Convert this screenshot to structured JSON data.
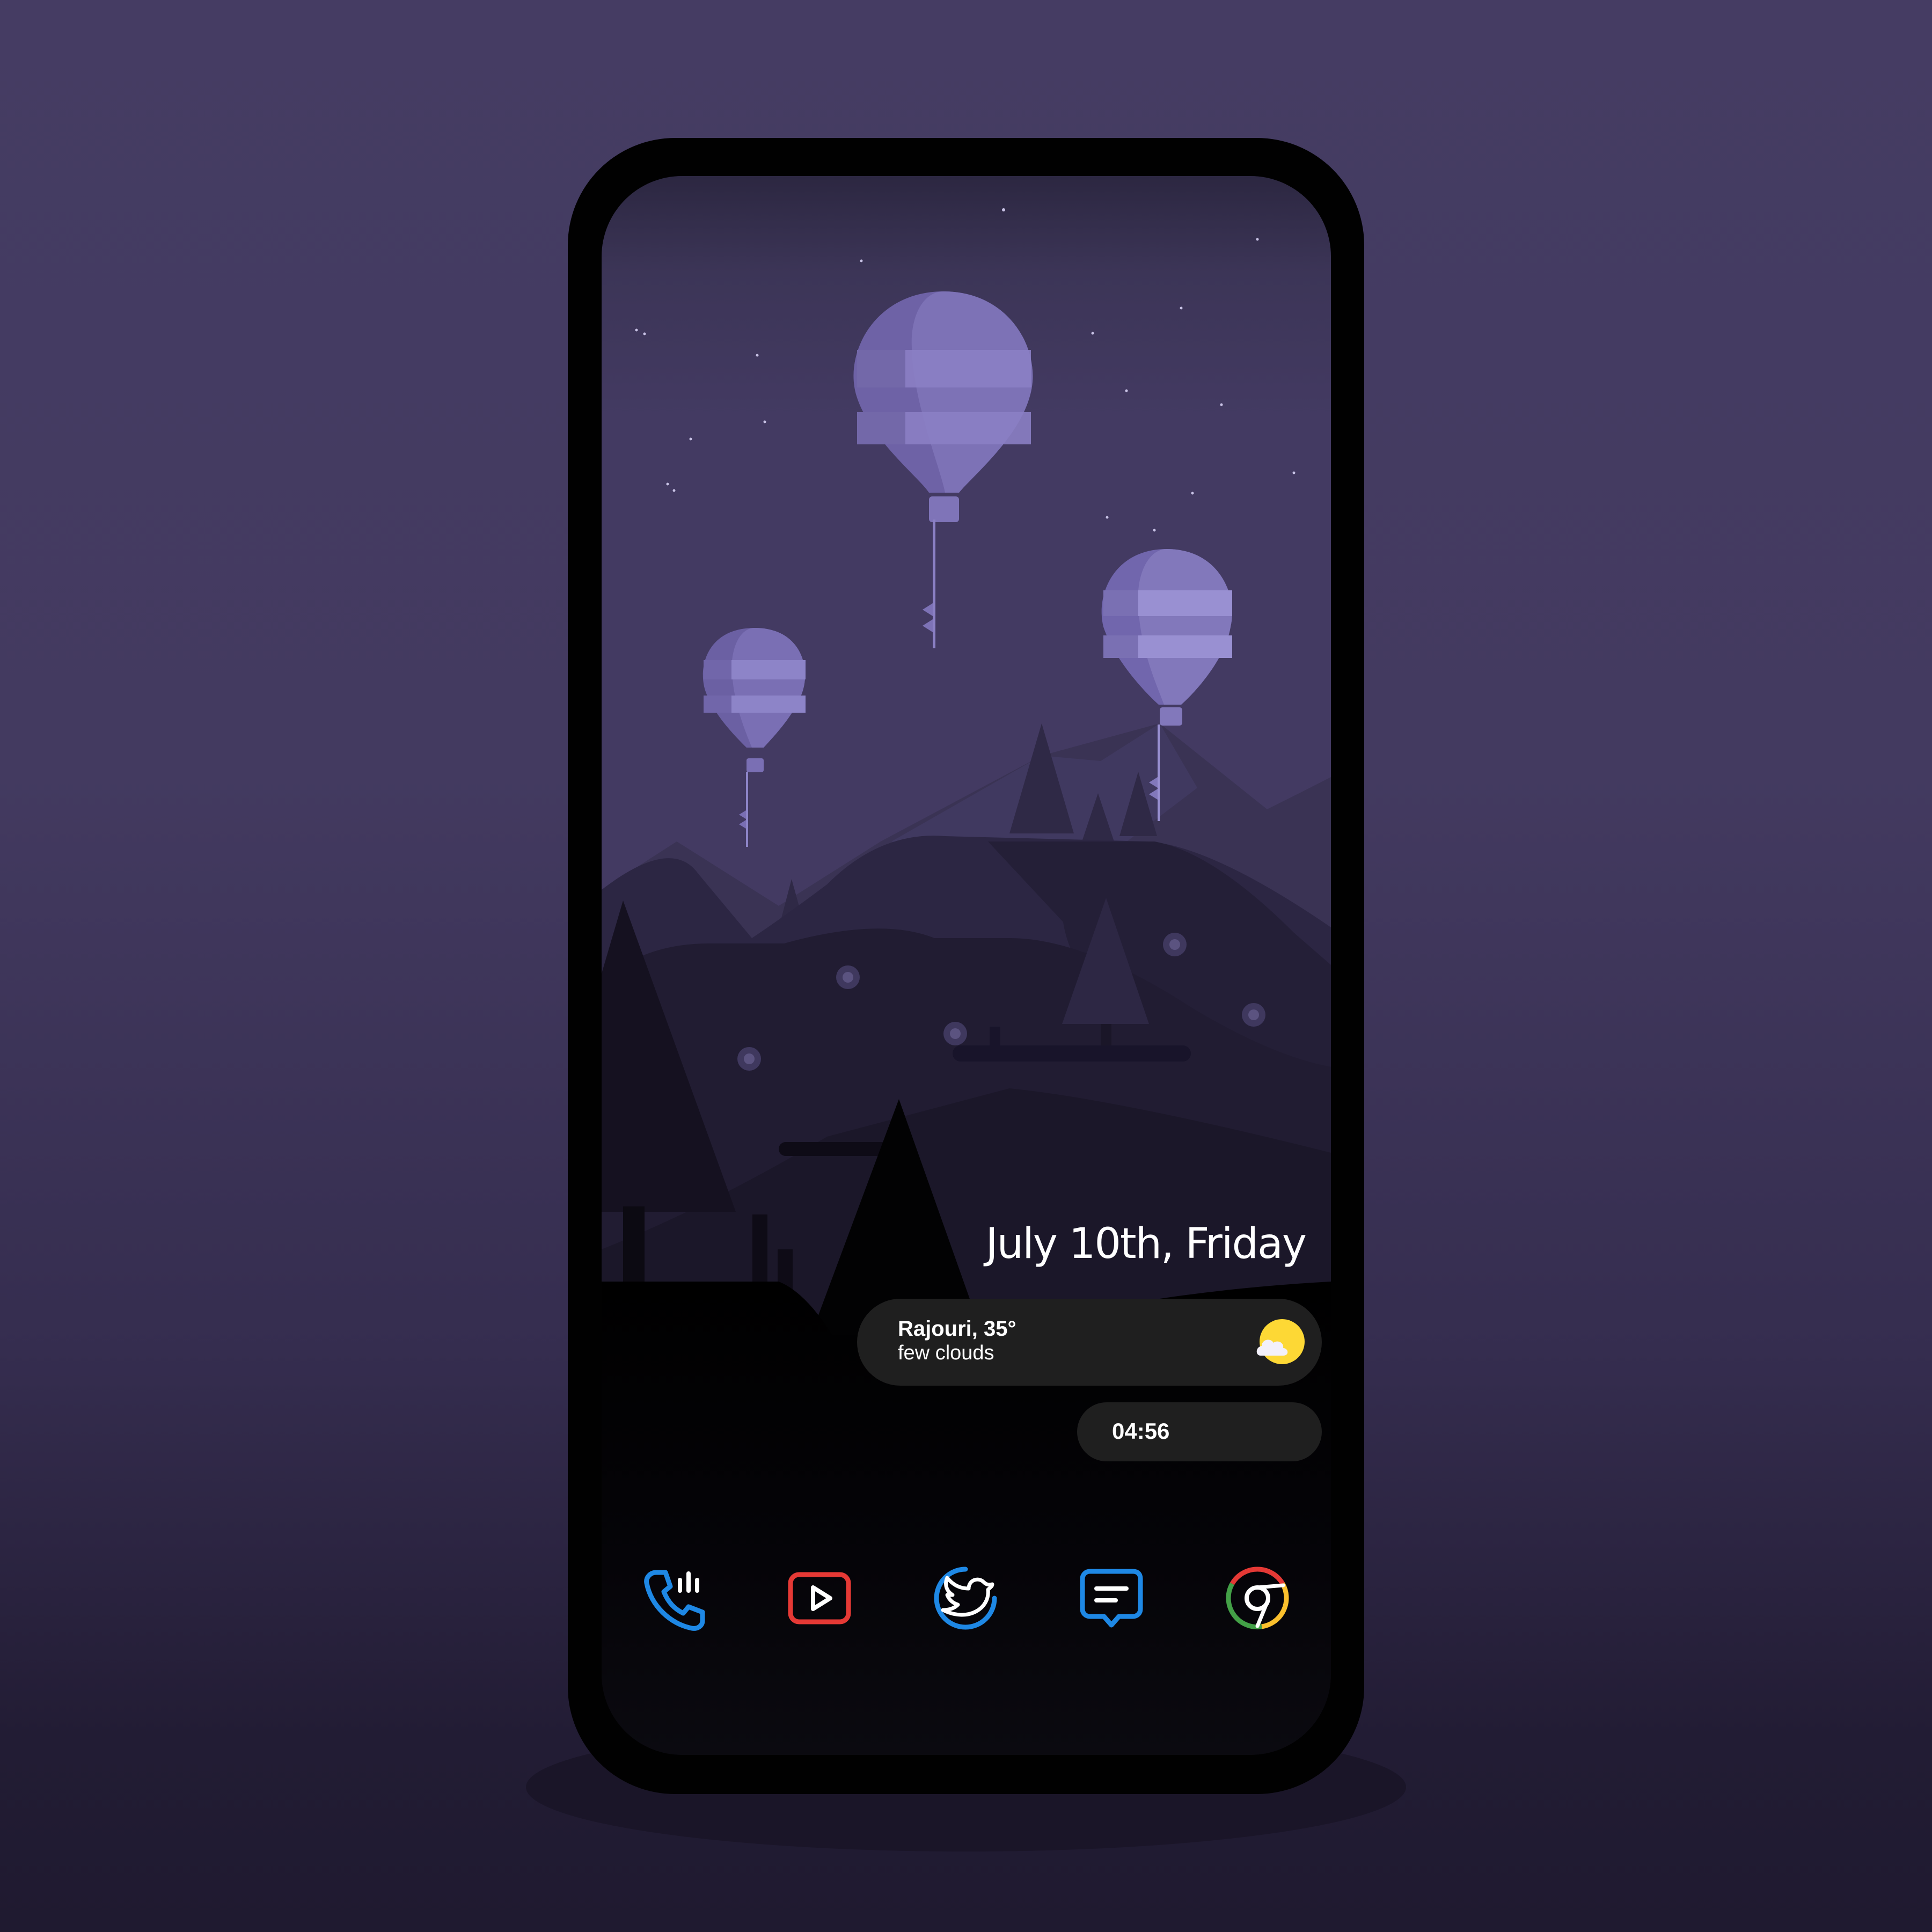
{
  "home_screen": {
    "date": "July 10th, Friday",
    "weather": {
      "location_temp": "Rajouri, 35°",
      "condition": "few clouds",
      "icon": "partly-cloudy-sun-icon"
    },
    "clock": {
      "time": "04:56"
    }
  },
  "dock": {
    "apps": [
      {
        "icon": "phone-icon",
        "color": "#1e88e5"
      },
      {
        "icon": "youtube-icon",
        "color": "#e53935"
      },
      {
        "icon": "twitter-icon",
        "color": "#1e88e5"
      },
      {
        "icon": "messages-icon",
        "color": "#1e88e5"
      },
      {
        "icon": "chrome-icon",
        "color": "#fbc02d"
      }
    ]
  },
  "colors": {
    "background": "#443b62",
    "pill_background": "#1f1f1f",
    "text": "#ffffff",
    "sun": "#fdd835",
    "balloon": "#8b7fc4"
  }
}
